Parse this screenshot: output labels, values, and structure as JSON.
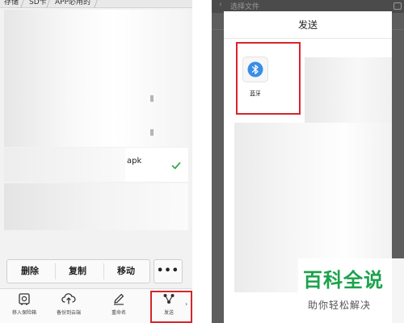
{
  "colors": {
    "highlight_red": "#d7252b",
    "check_green": "#3aa845",
    "bluetooth_blue": "#3a8ee6",
    "watermark_green": "#1ba24a",
    "overlay_gray": "#5d5d5d"
  },
  "left_screen": {
    "breadcrumb": [
      "存储",
      "SD卡",
      "APP必用的"
    ],
    "file": {
      "extension": "apk",
      "selected": true,
      "check_icon": "check-icon"
    },
    "actions": {
      "delete": "删除",
      "copy": "复制",
      "move": "移动",
      "more": "•••"
    },
    "toolbar": [
      {
        "label": "移入保险箱",
        "icon": "safe-icon"
      },
      {
        "label": "备份到云端",
        "icon": "cloud-upload-icon"
      },
      {
        "label": "重命名",
        "icon": "pencil-icon"
      },
      {
        "label": "发送",
        "icon": "share-icon"
      }
    ],
    "chevron": "›"
  },
  "right_screen": {
    "background_title": "选择文件",
    "background_back": "‹",
    "dialog": {
      "title": "发送",
      "options": [
        {
          "label": "蓝牙",
          "icon": "bluetooth-icon"
        }
      ]
    }
  },
  "watermark": {
    "main": "百科全说",
    "sub": "助你轻松解决"
  }
}
